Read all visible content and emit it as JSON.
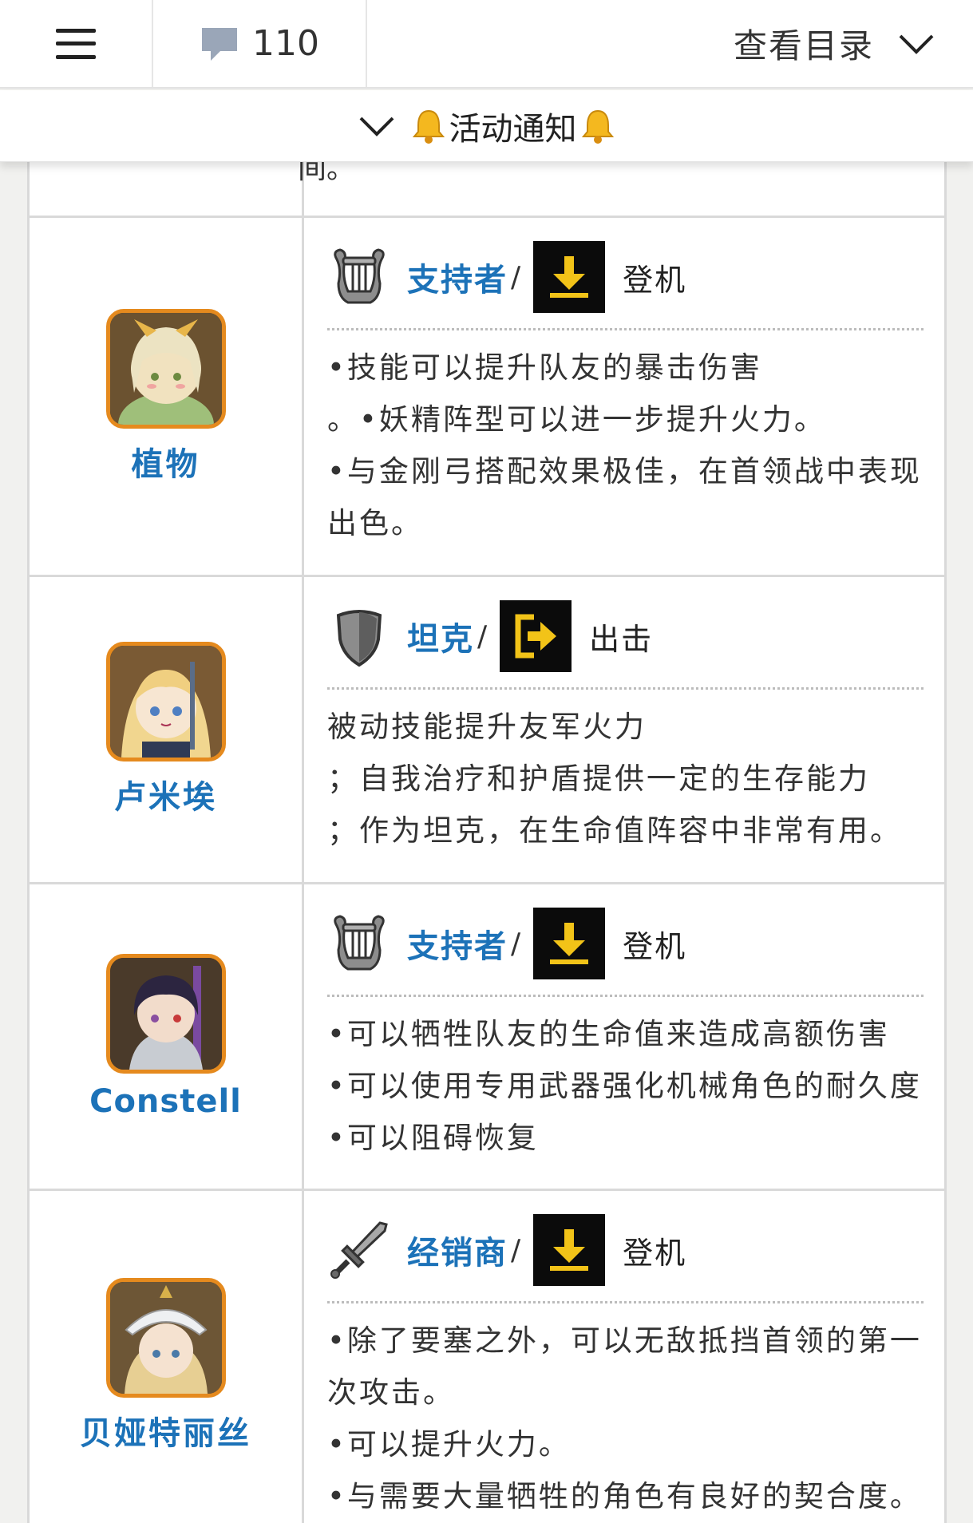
{
  "topbar": {
    "comment_count": "110",
    "toc_label": "查看目录"
  },
  "notice": {
    "label": "活动通知"
  },
  "partial_text": "间。",
  "rows": [
    {
      "name": "植物",
      "role": "支持者",
      "position": "登机",
      "role_icon": "lyre-icon",
      "position_icon": "download-arrow-icon",
      "lines": [
        "•技能可以提升队友的暴击伤害",
        "。•妖精阵型可以进一步提升火力。",
        "•与金刚弓搭配效果极佳，在首领战中表现",
        "出色。"
      ]
    },
    {
      "name": "卢米埃",
      "role": "坦克",
      "position": "出击",
      "role_icon": "shield-icon",
      "position_icon": "exit-arrow-icon",
      "lines": [
        "被动技能提升友军火力",
        "；自我治疗和护盾提供一定的生存能力",
        "；作为坦克，在生命值阵容中非常有用。"
      ]
    },
    {
      "name": "Constell",
      "role": "支持者",
      "position": "登机",
      "role_icon": "lyre-icon",
      "position_icon": "download-arrow-icon",
      "lines": [
        "•可以牺牲队友的生命值来造成高额伤害",
        "•可以使用专用武器强化机械角色的耐久度",
        "•可以阻碍恢复"
      ]
    },
    {
      "name": "贝娅特丽丝",
      "role": "经销商",
      "position": "登机",
      "role_icon": "sword-icon",
      "position_icon": "download-arrow-icon",
      "lines": [
        "•除了要塞之外，可以无敌抵挡首领的第一",
        "次攻击。",
        "•可以提升火力。",
        "•与需要大量牺牲的角色有良好的契合度。"
      ]
    }
  ],
  "colors": {
    "link_blue": "#1c72b8",
    "avatar_border": "#e58a1e",
    "position_yellow": "#f2c318"
  }
}
